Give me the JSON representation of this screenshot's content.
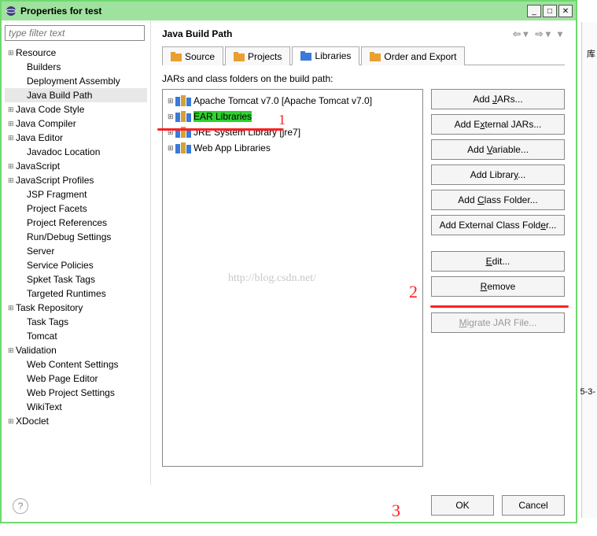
{
  "window": {
    "title": "Properties for test"
  },
  "filter_placeholder": "type filter text",
  "sidebar": {
    "items": [
      {
        "label": "Resource",
        "exp": "+"
      },
      {
        "label": "Builders"
      },
      {
        "label": "Deployment Assembly"
      },
      {
        "label": "Java Build Path",
        "selected": true
      },
      {
        "label": "Java Code Style",
        "exp": "+"
      },
      {
        "label": "Java Compiler",
        "exp": "+"
      },
      {
        "label": "Java Editor",
        "exp": "+"
      },
      {
        "label": "Javadoc Location"
      },
      {
        "label": "JavaScript",
        "exp": "+"
      },
      {
        "label": "JavaScript Profiles",
        "exp": "+"
      },
      {
        "label": "JSP Fragment"
      },
      {
        "label": "Project Facets"
      },
      {
        "label": "Project References"
      },
      {
        "label": "Run/Debug Settings"
      },
      {
        "label": "Server"
      },
      {
        "label": "Service Policies"
      },
      {
        "label": "Spket Task Tags"
      },
      {
        "label": "Targeted Runtimes"
      },
      {
        "label": "Task Repository",
        "exp": "+"
      },
      {
        "label": "Task Tags"
      },
      {
        "label": "Tomcat"
      },
      {
        "label": "Validation",
        "exp": "+"
      },
      {
        "label": "Web Content Settings"
      },
      {
        "label": "Web Page Editor"
      },
      {
        "label": "Web Project Settings"
      },
      {
        "label": "WikiText"
      },
      {
        "label": "XDoclet",
        "exp": "+"
      }
    ]
  },
  "page": {
    "title": "Java Build Path"
  },
  "tabs": [
    {
      "label": "Source"
    },
    {
      "label": "Projects"
    },
    {
      "label": "Libraries",
      "active": true
    },
    {
      "label": "Order and Export"
    }
  ],
  "jar_section": {
    "label": "JARs and class folders on the build path:",
    "items": [
      {
        "label": "Apache Tomcat v7.0 [Apache Tomcat v7.0]"
      },
      {
        "label": "EAR Libraries",
        "selected": true
      },
      {
        "label": "JRE System Library [jre7]"
      },
      {
        "label": "Web App Libraries"
      }
    ]
  },
  "buttons": {
    "add_jars": "Add JARs...",
    "add_ext_jars": "Add External JARs...",
    "add_var": "Add Variable...",
    "add_lib": "Add Library...",
    "add_class": "Add Class Folder...",
    "add_ext_class": "Add External Class Folder...",
    "edit": "Edit...",
    "remove": "Remove",
    "migrate": "Migrate JAR File..."
  },
  "bottom_buttons": {
    "ok": "OK",
    "cancel": "Cancel"
  },
  "watermark": "http://blog.csdn.net/",
  "annotations": {
    "a1": "1",
    "a2": "2",
    "a3": "3"
  },
  "right": {
    "t1": "库",
    "t2": "5-3-"
  }
}
